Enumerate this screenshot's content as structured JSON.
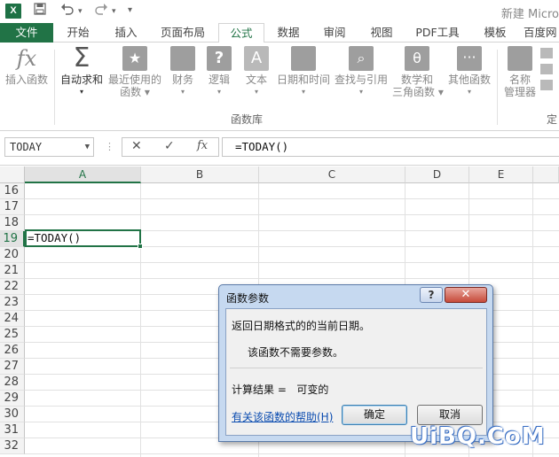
{
  "titlebar": {
    "app_icon": "X",
    "doc_title": "新建 Micro"
  },
  "tabs": [
    {
      "label": "文件"
    },
    {
      "label": "开始"
    },
    {
      "label": "插入"
    },
    {
      "label": "页面布局"
    },
    {
      "label": "公式"
    },
    {
      "label": "数据"
    },
    {
      "label": "审阅"
    },
    {
      "label": "视图"
    },
    {
      "label": "PDF工具"
    },
    {
      "label": "模板"
    },
    {
      "label": "百度网"
    }
  ],
  "ribbon": {
    "insert_function": "插入函数",
    "autosum": "自动求和",
    "recent_1": "最近使用的",
    "recent_2": "函数",
    "financial": "财务",
    "logical": "逻辑",
    "text": "文本",
    "datetime": "日期和时间",
    "lookup": "查找与引用",
    "math_1": "数学和",
    "math_2": "三角函数",
    "other": "其他函数",
    "name_mgr_1": "名称",
    "name_mgr_2": "管理器",
    "group_label": "函数库",
    "group_label2": "定"
  },
  "formula_bar": {
    "name_box": "TODAY",
    "cancel_glyph": "✕",
    "enter_glyph": "✓",
    "fx_glyph": "fx",
    "formula": "=TODAY()"
  },
  "grid": {
    "columns": [
      "A",
      "B",
      "C",
      "D",
      "E"
    ],
    "rows": [
      "16",
      "17",
      "18",
      "19",
      "20",
      "21",
      "22",
      "23",
      "24",
      "25",
      "26",
      "27",
      "28",
      "29",
      "30",
      "31",
      "32"
    ],
    "active_cell_value": "=TODAY()"
  },
  "dialog": {
    "title": "函数参数",
    "help_glyph": "?",
    "close_glyph": "✕",
    "description": "返回日期格式的的当前日期。",
    "no_args": "该函数不需要参数。",
    "result_label": "计算结果 =",
    "result_value": "可变的",
    "help_link": "有关该函数的帮助(H)",
    "ok": "确定",
    "cancel": "取消"
  },
  "watermark": "UiBQ.CoM",
  "colors": {
    "accent": "#217346",
    "dialog_frame": "#c6d9f0",
    "close_button": "#c74b3a",
    "link": "#0b4cb0"
  }
}
